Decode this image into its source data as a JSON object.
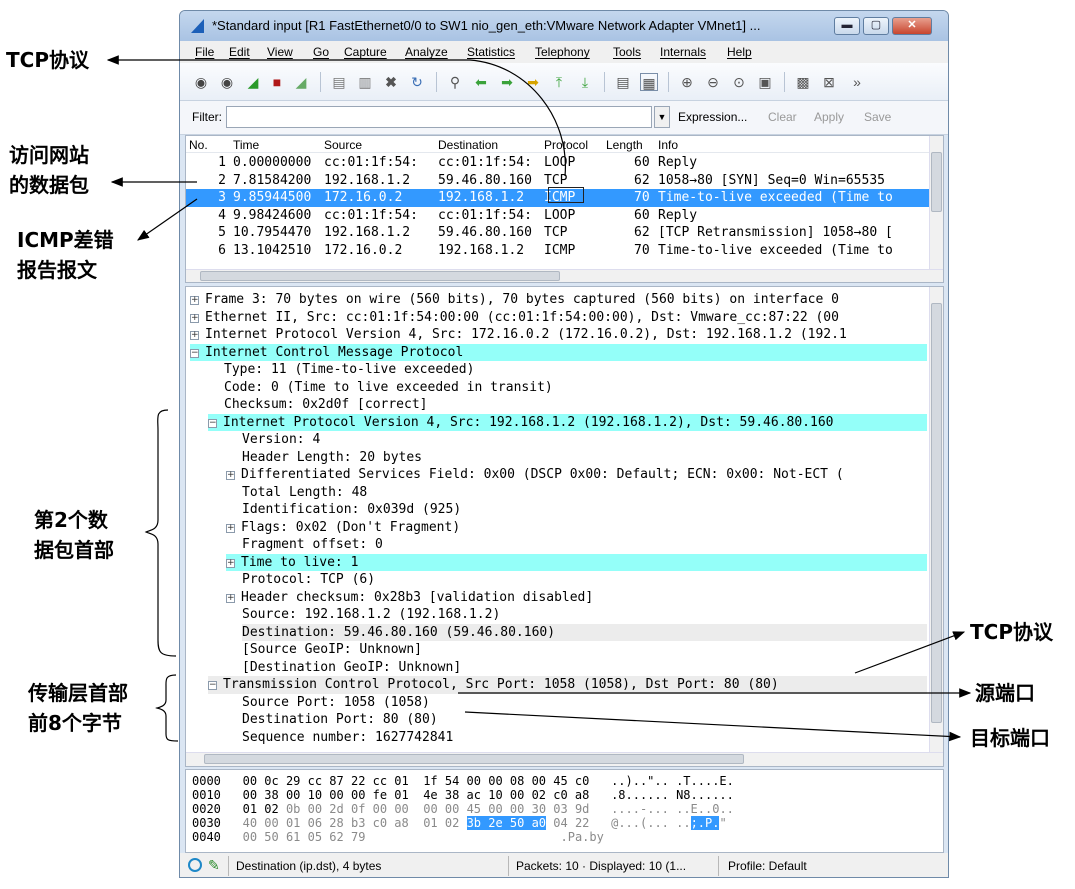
{
  "window": {
    "title": "*Standard input   [R1 FastEthernet0/0 to SW1 nio_gen_eth:VMware Network Adapter VMnet1]   ..."
  },
  "menu": [
    "File",
    "Edit",
    "View",
    "Go",
    "Capture",
    "Analyze",
    "Statistics",
    "Telephony",
    "Tools",
    "Internals",
    "Help"
  ],
  "filter": {
    "label": "Filter:",
    "value": "",
    "expression": "Expression...",
    "clear": "Clear",
    "apply": "Apply",
    "save": "Save"
  },
  "packet_list": {
    "columns": [
      "No.",
      "Time",
      "Source",
      "Destination",
      "Protocol",
      "Length",
      "Info"
    ],
    "rows": [
      {
        "no": "1",
        "time": "0.00000000",
        "src": "cc:01:1f:54:",
        "dst": "cc:01:1f:54:",
        "proto": "LOOP",
        "len": "60",
        "info": "Reply"
      },
      {
        "no": "2",
        "time": "7.81584200",
        "src": "192.168.1.2",
        "dst": "59.46.80.160",
        "proto": "TCP",
        "len": "62",
        "info": "1058→80 [SYN] Seq=0 Win=65535"
      },
      {
        "no": "3",
        "time": "9.85944500",
        "src": "172.16.0.2",
        "dst": "192.168.1.2",
        "proto": "ICMP",
        "len": "70",
        "info": "Time-to-live exceeded (Time to"
      },
      {
        "no": "4",
        "time": "9.98424600",
        "src": "cc:01:1f:54:",
        "dst": "cc:01:1f:54:",
        "proto": "LOOP",
        "len": "60",
        "info": "Reply"
      },
      {
        "no": "5",
        "time": "10.7954470",
        "src": "192.168.1.2",
        "dst": "59.46.80.160",
        "proto": "TCP",
        "len": "62",
        "info": "[TCP Retransmission] 1058→80 ["
      },
      {
        "no": "6",
        "time": "13.1042510",
        "src": "172.16.0.2",
        "dst": "192.168.1.2",
        "proto": "ICMP",
        "len": "70",
        "info": "Time-to-live exceeded (Time to"
      }
    ]
  },
  "details": [
    {
      "t": "Frame 3: 70 bytes on wire (560 bits), 70 bytes captured (560 bits) on interface 0"
    },
    {
      "t": "Ethernet II, Src: cc:01:1f:54:00:00 (cc:01:1f:54:00:00), Dst: Vmware_cc:87:22 (00"
    },
    {
      "t": "Internet Protocol Version 4, Src: 172.16.0.2 (172.16.0.2), Dst: 192.168.1.2 (192.1"
    },
    {
      "t": "Internet Control Message Protocol"
    },
    {
      "t": "Type: 11 (Time-to-live exceeded)"
    },
    {
      "t": "Code: 0 (Time to live exceeded in transit)"
    },
    {
      "t": "Checksum: 0x2d0f [correct]"
    },
    {
      "t": "Internet Protocol Version 4, Src: 192.168.1.2 (192.168.1.2), Dst: 59.46.80.160"
    },
    {
      "t": "Version: 4"
    },
    {
      "t": "Header Length: 20 bytes"
    },
    {
      "t": "Differentiated Services Field: 0x00 (DSCP 0x00: Default; ECN: 0x00: Not-ECT ("
    },
    {
      "t": "Total Length: 48"
    },
    {
      "t": "Identification: 0x039d (925)"
    },
    {
      "t": "Flags: 0x02 (Don't Fragment)"
    },
    {
      "t": "Fragment offset: 0"
    },
    {
      "t": "Time to live: 1"
    },
    {
      "t": "Protocol: TCP (6)"
    },
    {
      "t": "Header checksum: 0x28b3 [validation disabled]"
    },
    {
      "t": "Source: 192.168.1.2 (192.168.1.2)"
    },
    {
      "t": "Destination: 59.46.80.160 (59.46.80.160)"
    },
    {
      "t": "[Source GeoIP: Unknown]"
    },
    {
      "t": "[Destination GeoIP: Unknown]"
    },
    {
      "t": "Transmission Control Protocol, Src Port: 1058 (1058), Dst Port: 80 (80)"
    },
    {
      "t": "Source Port: 1058 (1058)"
    },
    {
      "t": "Destination Port: 80 (80)"
    },
    {
      "t": "Sequence number: 1627742841"
    }
  ],
  "hex": [
    {
      "off": "0000",
      "bytes": "00 0c 29 cc 87 22 cc 01  1f 54 00 00 08 00 45 c0",
      "ascii": "..)..\".. .T....E."
    },
    {
      "off": "0010",
      "bytes": "00 38 00 10 00 00 fe 01  4e 38 ac 10 00 02 c0 a8",
      "ascii": ".8...... N8......"
    },
    {
      "off": "0020",
      "bytes_a": "01 02 ",
      "bytes_b": "0b 00 2d 0f 00 00  00 00 45 00 00 30 03 9d",
      "ascii": "....-... ..E..0.."
    },
    {
      "off": "0030",
      "bytes_a": "40 00 01 06 28 b3 c0 a8  01 02 ",
      "bytes_sel": "3b 2e 50 a0",
      "bytes_c": " 04 22",
      "ascii_a": "@...(... ..",
      "ascii_sel": ";.P.",
      "ascii_c": "\""
    },
    {
      "off": "0040",
      "bytes": "00 50 61 05 62 79",
      "ascii": ".Pa.by"
    }
  ],
  "status": {
    "field": "Destination (ip.dst), 4 bytes",
    "packets": "Packets: 10 · Displayed: 10 (1...",
    "profile": "Profile: Default"
  },
  "annotations": {
    "tcp_top": "TCP协议",
    "visit_line1": "访问网站",
    "visit_line2": "的数据包",
    "icmp_line1": "ICMP差错",
    "icmp_line2": "报告报文",
    "hdr_line1": "第2个数",
    "hdr_line2": "据包首部",
    "trans_line1": "传输层首部",
    "trans_line2": "前8个字节",
    "tcp_right": "TCP协议",
    "src_port": "源端口",
    "dst_port": "目标端口"
  }
}
